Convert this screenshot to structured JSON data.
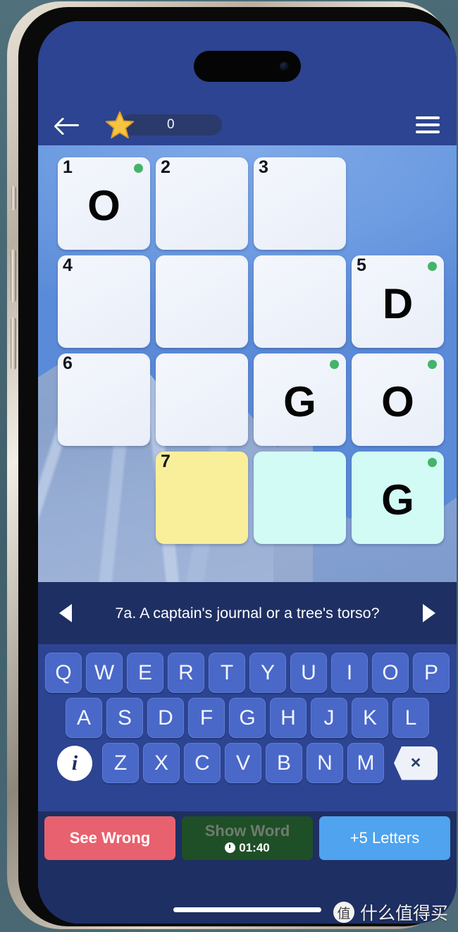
{
  "app": {
    "topbar": {
      "back_icon": "back-arrow-icon",
      "star_icon": "star-icon",
      "score": "0",
      "menu_icon": "hamburger-menu-icon"
    },
    "board": {
      "rows": 4,
      "cols": 4,
      "cells": [
        {
          "r": 1,
          "c": 1,
          "exists": true,
          "num": "1",
          "letter": "O",
          "dot": true,
          "state": "normal"
        },
        {
          "r": 1,
          "c": 2,
          "exists": true,
          "num": "2",
          "letter": "",
          "dot": false,
          "state": "normal"
        },
        {
          "r": 1,
          "c": 3,
          "exists": true,
          "num": "3",
          "letter": "",
          "dot": false,
          "state": "normal"
        },
        {
          "r": 1,
          "c": 4,
          "exists": false,
          "num": "",
          "letter": "",
          "dot": false,
          "state": "empty"
        },
        {
          "r": 2,
          "c": 1,
          "exists": true,
          "num": "4",
          "letter": "",
          "dot": false,
          "state": "normal"
        },
        {
          "r": 2,
          "c": 2,
          "exists": true,
          "num": "",
          "letter": "",
          "dot": false,
          "state": "normal"
        },
        {
          "r": 2,
          "c": 3,
          "exists": true,
          "num": "",
          "letter": "",
          "dot": false,
          "state": "normal"
        },
        {
          "r": 2,
          "c": 4,
          "exists": true,
          "num": "5",
          "letter": "D",
          "dot": true,
          "state": "normal"
        },
        {
          "r": 3,
          "c": 1,
          "exists": true,
          "num": "6",
          "letter": "",
          "dot": false,
          "state": "normal"
        },
        {
          "r": 3,
          "c": 2,
          "exists": true,
          "num": "",
          "letter": "",
          "dot": false,
          "state": "normal"
        },
        {
          "r": 3,
          "c": 3,
          "exists": true,
          "num": "",
          "letter": "G",
          "dot": true,
          "state": "normal"
        },
        {
          "r": 3,
          "c": 4,
          "exists": true,
          "num": "",
          "letter": "O",
          "dot": true,
          "state": "normal"
        },
        {
          "r": 4,
          "c": 1,
          "exists": false,
          "num": "",
          "letter": "",
          "dot": false,
          "state": "empty"
        },
        {
          "r": 4,
          "c": 2,
          "exists": true,
          "num": "7",
          "letter": "",
          "dot": false,
          "state": "active"
        },
        {
          "r": 4,
          "c": 3,
          "exists": true,
          "num": "",
          "letter": "",
          "dot": false,
          "state": "highlight"
        },
        {
          "r": 4,
          "c": 4,
          "exists": true,
          "num": "",
          "letter": "G",
          "dot": true,
          "state": "highlight"
        }
      ]
    },
    "clue": {
      "prev_icon": "previous-clue-arrow-icon",
      "next_icon": "next-clue-arrow-icon",
      "text": "7a. A captain's journal or a tree's torso?"
    },
    "keyboard": {
      "row1": [
        "Q",
        "W",
        "E",
        "R",
        "T",
        "Y",
        "U",
        "I",
        "O",
        "P"
      ],
      "row2": [
        "A",
        "S",
        "D",
        "F",
        "G",
        "H",
        "J",
        "K",
        "L"
      ],
      "row3": [
        "Z",
        "X",
        "C",
        "V",
        "B",
        "N",
        "M"
      ],
      "info_label": "i",
      "backspace_label": "×"
    },
    "actions": {
      "see_wrong": "See Wrong",
      "show_word": "Show Word",
      "show_word_timer": "01:40",
      "plus_letters": "+5 Letters"
    },
    "watermark": {
      "logo": "值",
      "text": "什么值得买"
    },
    "colors": {
      "header_blue": "#2c4491",
      "deep_navy": "#1e2f63",
      "sky_blue": "#6e9ce2",
      "cell_white": "#eef2fa",
      "cell_highlight": "#d2fbf6",
      "cell_active": "#f9ef9b",
      "dot_green": "#45b36b",
      "key_blue": "#4968c8",
      "red_button": "#e8616e",
      "green_button": "#1f4f26",
      "blue_button": "#4fa3ef",
      "star_yellow": "#f5c542"
    }
  }
}
